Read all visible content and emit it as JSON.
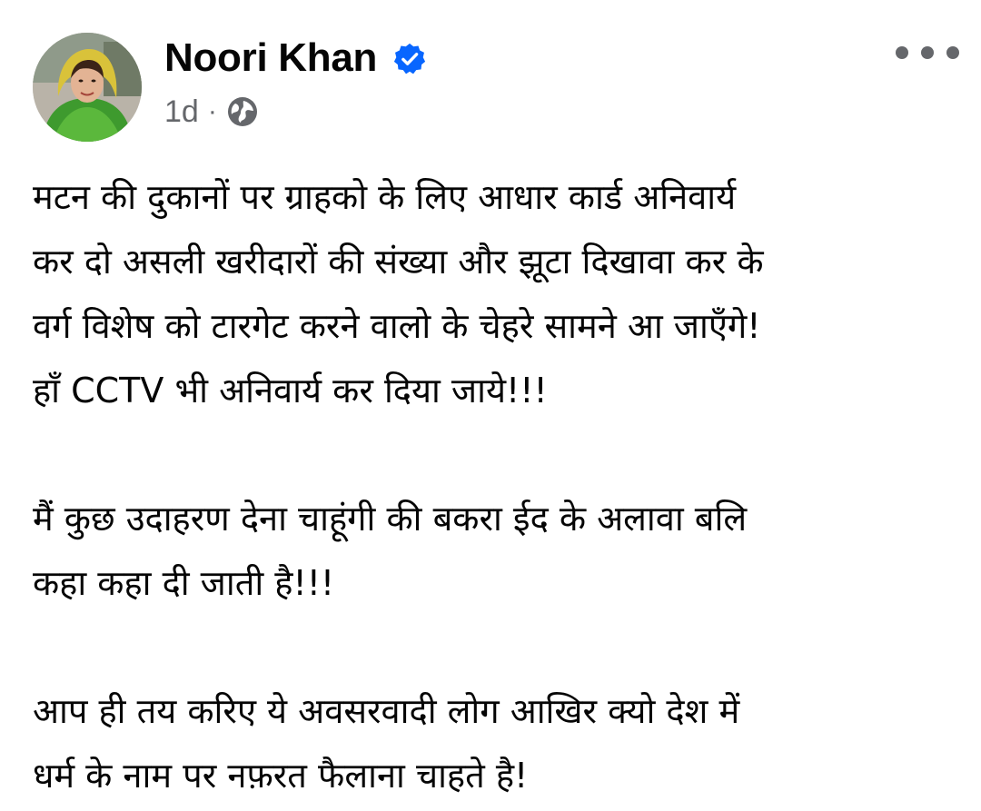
{
  "post": {
    "author": {
      "name": "Noori Khan",
      "verified": true
    },
    "time": "1d",
    "separator": "·",
    "audience_icon": "globe-icon",
    "more_icon": "more-options-icon",
    "paragraphs": [
      {
        "lines": [
          "मटन की दुकानों पर ग्राहको के लिए आधार कार्ड अनिवार्य",
          "कर दो असली खरीदारों की संख्या और झूटा दिखावा कर के",
          "वर्ग विशेष को टारगेट करने वालो के चेहरे सामने आ जाएँगे!",
          "हाँ CCTV भी अनिवार्य कर दिया जाये!!!"
        ]
      },
      {
        "lines": [
          "मैं कुछ उदाहरण देना चाहूंगी की बकरा ईद के अलावा बलि",
          "कहा कहा दी जाती है!!!"
        ]
      },
      {
        "lines": [
          "आप ही तय करिए ये अवसरवादी लोग आखिर क्यो देश में",
          "धर्म के नाम पर नफ़रत फैलाना चाहते है!"
        ]
      }
    ]
  },
  "colors": {
    "text_primary": "#050505",
    "text_secondary": "#65676b",
    "verified_blue": "#0866ff",
    "background": "#ffffff"
  }
}
